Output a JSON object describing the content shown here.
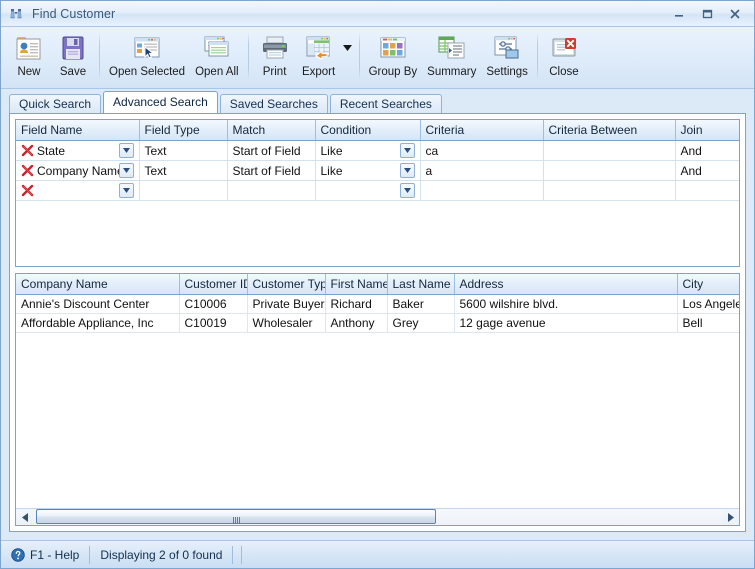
{
  "window": {
    "title": "Find Customer",
    "title_icon": "binoculars-icon",
    "minimize_label": "Minimize",
    "maximize_label": "Maximize",
    "close_label": "Close"
  },
  "toolbar": {
    "items": [
      {
        "label": "New",
        "icon": "new-record-icon"
      },
      {
        "label": "Save",
        "icon": "floppy-disk-icon"
      },
      {
        "label": "Open Selected",
        "icon": "open-selected-icon"
      },
      {
        "label": "Open All",
        "icon": "open-all-icon"
      },
      {
        "label": "Print",
        "icon": "printer-icon"
      },
      {
        "label": "Export",
        "icon": "export-icon"
      },
      {
        "label": "Group By",
        "icon": "group-by-icon"
      },
      {
        "label": "Summary",
        "icon": "summary-icon"
      },
      {
        "label": "Settings",
        "icon": "settings-icon"
      },
      {
        "label": "Close",
        "icon": "close-window-icon"
      }
    ]
  },
  "tabs": [
    {
      "label": "Quick Search",
      "active": false
    },
    {
      "label": "Advanced Search",
      "active": true
    },
    {
      "label": "Saved Searches",
      "active": false
    },
    {
      "label": "Recent Searches",
      "active": false
    }
  ],
  "criteria_grid": {
    "columns": [
      "Field Name",
      "Field Type",
      "Match",
      "Condition",
      "Criteria",
      "Criteria Between",
      "Join"
    ],
    "rows": [
      {
        "field_name": "State",
        "field_type": "Text",
        "match": "Start of Field",
        "condition": "Like",
        "criteria": "ca",
        "criteria_between": "",
        "join": "And"
      },
      {
        "field_name": "Company Name",
        "field_type": "Text",
        "match": "Start of Field",
        "condition": "Like",
        "criteria": "a",
        "criteria_between": "",
        "join": "And"
      },
      {
        "field_name": "",
        "field_type": "",
        "match": "",
        "condition": "",
        "criteria": "",
        "criteria_between": "",
        "join": ""
      }
    ]
  },
  "results_grid": {
    "columns": [
      "Company Name",
      "Customer ID",
      "Customer Type",
      "First Name",
      "Last Name",
      "Address",
      "City"
    ],
    "rows": [
      {
        "company_name": "Annie's Discount Center",
        "customer_id": "C10006",
        "customer_type": "Private Buyer",
        "first_name": "Richard",
        "last_name": "Baker",
        "address": "5600 wilshire blvd.",
        "city": "Los Angeles"
      },
      {
        "company_name": "Affordable Appliance, Inc",
        "customer_id": "C10019",
        "customer_type": "Wholesaler",
        "first_name": "Anthony",
        "last_name": "Grey",
        "address": "12 gage avenue",
        "city": "Bell"
      }
    ]
  },
  "statusbar": {
    "help_icon": "help-icon",
    "help_label": "F1 - Help",
    "count_label": "Displaying 2 of 0 found"
  },
  "colors": {
    "accent": "#7ba3cd",
    "panel": "#dce9f7",
    "header_gradient_top": "#f4f9fe",
    "header_gradient_bottom": "#d6e6f7",
    "delete_icon": "#c1272d",
    "dropdown_chevron": "#2a4f7e"
  }
}
